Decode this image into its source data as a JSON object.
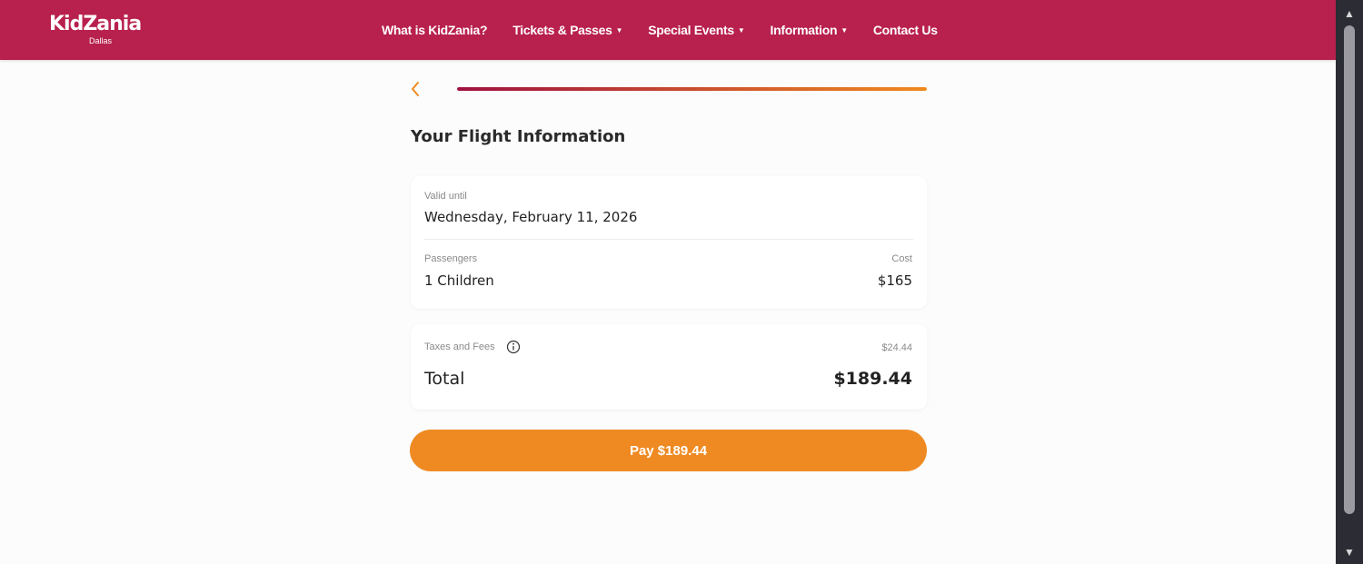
{
  "brand": {
    "name": "KidZania",
    "location": "Dallas"
  },
  "nav": {
    "items": [
      {
        "label": "What is KidZania?",
        "has_dropdown": false
      },
      {
        "label": "Tickets & Passes",
        "has_dropdown": true
      },
      {
        "label": "Special Events",
        "has_dropdown": true
      },
      {
        "label": "Information",
        "has_dropdown": true
      },
      {
        "label": "Contact Us",
        "has_dropdown": false
      }
    ]
  },
  "progress": {
    "fraction": 1.0
  },
  "page": {
    "title": "Your Flight Information"
  },
  "flight": {
    "valid_label": "Valid until",
    "valid_value": "Wednesday, February 11, 2026",
    "passengers_label": "Passengers",
    "passengers_value": "1 Children",
    "cost_label": "Cost",
    "cost_value": "$165"
  },
  "summary": {
    "taxes_label": "Taxes and Fees",
    "taxes_value": "$24.44",
    "total_label": "Total",
    "total_value": "$189.44"
  },
  "pay_button": {
    "label": "Pay $189.44"
  },
  "icons": {
    "back": "chevron-left-icon",
    "info": "info-icon",
    "caret": "caret-down-icon"
  },
  "colors": {
    "header": "#b8204d",
    "accent": "#ef8a22",
    "progress_start": "#a01040",
    "progress_end": "#f08a1e"
  }
}
